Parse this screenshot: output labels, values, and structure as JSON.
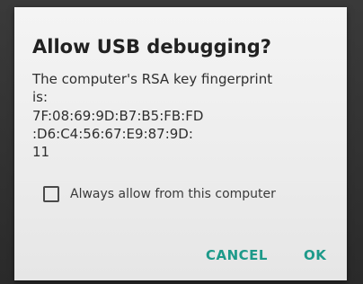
{
  "dialog": {
    "title": "Allow USB debugging?",
    "message_lines": [
      "The computer's RSA key fingerprint",
      "is:",
      "7F:08:69:9D:B7:B5:FB:FD",
      ":D6:C4:56:67:E9:87:9D:",
      "11"
    ],
    "checkbox": {
      "label": "Always allow from this computer",
      "checked": false
    },
    "buttons": {
      "cancel_label": "CANCEL",
      "ok_label": "OK"
    },
    "accent_color": "#1d9a8a"
  }
}
